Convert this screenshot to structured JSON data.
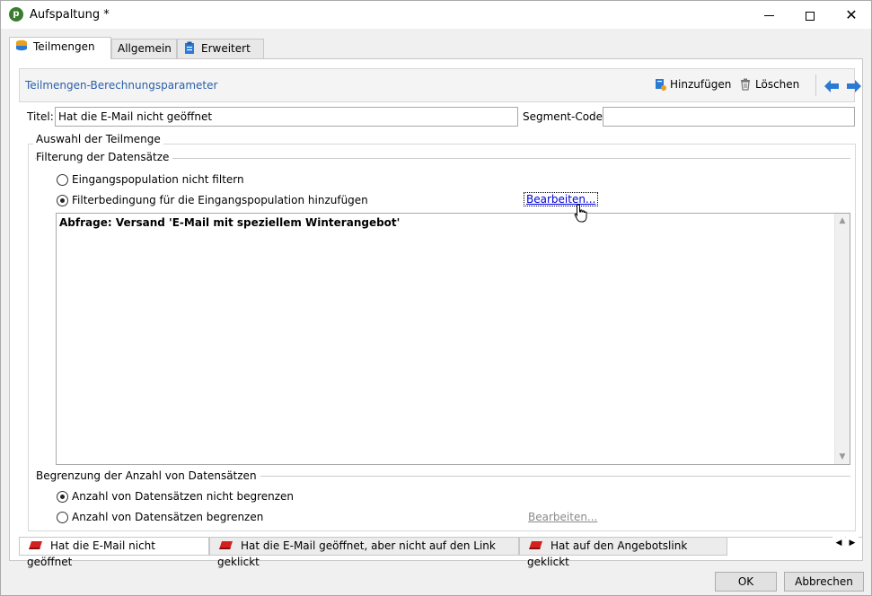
{
  "window": {
    "title": "Aufspaltung *"
  },
  "tabs": [
    {
      "label": "Teilmengen"
    },
    {
      "label": "Allgemein"
    },
    {
      "label": "Erweitert"
    }
  ],
  "subheader": {
    "title": "Teilmengen-Berechnungsparameter",
    "add_label": "Hinzufügen",
    "delete_label": "Löschen"
  },
  "form": {
    "title_label": "Titel:",
    "title_value": "Hat die E-Mail nicht geöffnet",
    "segment_label": "Segment-Code:",
    "segment_value": ""
  },
  "selection": {
    "group_title": "Auswahl der Teilmenge",
    "filter_section": "Filterung der Datensätze",
    "radio_no_filter": "Eingangspopulation nicht filtern",
    "radio_add_filter": "Filterbedingung für die Eingangspopulation hinzufügen",
    "edit_link": "Bearbeiten...",
    "query_text": "Abfrage: Versand 'E-Mail mit speziellem Winterangebot'",
    "limit_section": "Begrenzung der Anzahl von Datensätzen",
    "radio_no_limit": "Anzahl von Datensätzen nicht begrenzen",
    "radio_limit": "Anzahl von Datensätzen begrenzen",
    "limit_edit_link": "Bearbeiten..."
  },
  "bottom_tabs": [
    {
      "label": "Hat die E-Mail nicht geöffnet"
    },
    {
      "label": "Hat die E-Mail geöffnet, aber nicht auf den Link geklickt"
    },
    {
      "label": "Hat auf den Angebotslink geklickt"
    }
  ],
  "buttons": {
    "ok": "OK",
    "cancel": "Abbrechen"
  },
  "colors": {
    "accent_blue": "#2a7ad4",
    "link_blue": "#0000d8",
    "header_text": "#2a5ea8",
    "tab_icon_red": "#d42020"
  },
  "icons": [
    "app-icon",
    "database-icon",
    "clipboard-icon",
    "add-icon",
    "trash-icon",
    "arrow-left-icon",
    "arrow-right-icon",
    "hand-cursor-icon",
    "segment-icon"
  ]
}
